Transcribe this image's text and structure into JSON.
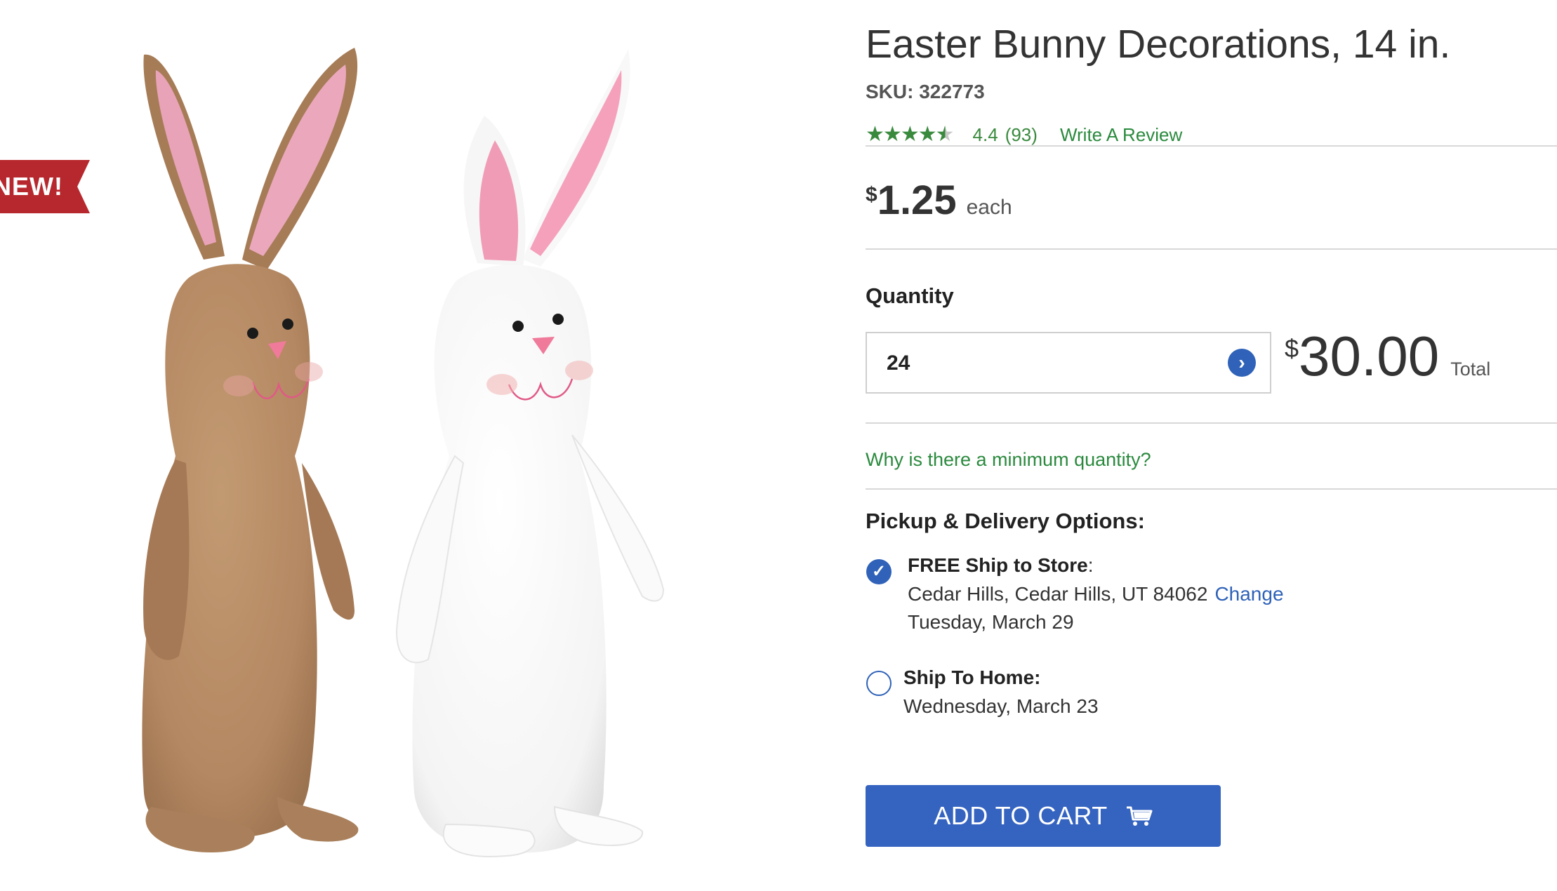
{
  "badge": {
    "text": "NEW!"
  },
  "product": {
    "title": "Easter Bunny Decorations, 14 in.",
    "sku": "SKU: 322773",
    "rating": {
      "value": "4.4",
      "count": "(93)",
      "stars": 4.4,
      "write_review": "Write A Review"
    },
    "price": {
      "currency": "$",
      "amount": "1.25",
      "unit": "each"
    }
  },
  "quantity": {
    "label": "Quantity",
    "value": "24",
    "total_currency": "$",
    "total_amount": "30.00",
    "total_label": "Total",
    "min_qty_link": "Why is there a minimum quantity?"
  },
  "pickup": {
    "title": "Pickup & Delivery Options:",
    "options": [
      {
        "label": "FREE Ship to Store",
        "suffix": ":",
        "location": "Cedar Hills, Cedar Hills, UT 84062",
        "change": "Change",
        "date": "Tuesday, March 29",
        "selected": true
      },
      {
        "label": "Ship To Home:",
        "date": "Wednesday, March 23",
        "selected": false
      }
    ]
  },
  "cart": {
    "label": "ADD TO CART",
    "icon": "cart-icon"
  },
  "colors": {
    "accent_blue": "#3563c0",
    "link_green": "#2b8a3e",
    "badge_red": "#b7282e"
  }
}
